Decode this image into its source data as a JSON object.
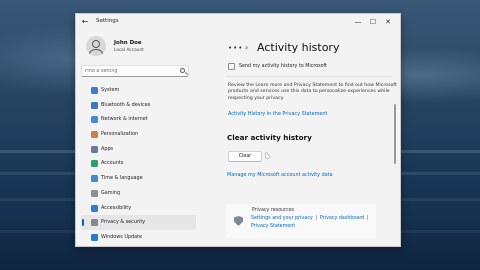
{
  "window": {
    "title": "Settings",
    "controls": {
      "minimize": "—",
      "maximize": "☐",
      "close": "✕"
    }
  },
  "user": {
    "name": "John Doe",
    "account": "Local Account"
  },
  "search": {
    "placeholder": "Find a setting"
  },
  "sidebar": {
    "items": [
      {
        "label": "System",
        "icon": "system-icon",
        "color": "#3b7dd8"
      },
      {
        "label": "Bluetooth & devices",
        "icon": "bluetooth-icon",
        "color": "#3c78c4"
      },
      {
        "label": "Network & internet",
        "icon": "network-icon",
        "color": "#4a88d6"
      },
      {
        "label": "Personalization",
        "icon": "personalization-icon",
        "color": "#d27a4a"
      },
      {
        "label": "Apps",
        "icon": "apps-icon",
        "color": "#6b7c93"
      },
      {
        "label": "Accounts",
        "icon": "accounts-icon",
        "color": "#2f9e6d"
      },
      {
        "label": "Time & language",
        "icon": "time-language-icon",
        "color": "#3a8fd0"
      },
      {
        "label": "Gaming",
        "icon": "gaming-icon",
        "color": "#8b8f97"
      },
      {
        "label": "Accessibility",
        "icon": "accessibility-icon",
        "color": "#2e7fd3"
      },
      {
        "label": "Privacy & security",
        "icon": "privacy-shield-icon",
        "color": "#7f8792"
      },
      {
        "label": "Windows Update",
        "icon": "windows-update-icon",
        "color": "#2b78d0"
      }
    ],
    "active_index": 9
  },
  "breadcrumb": {
    "dots": "•••",
    "separator": "›"
  },
  "page": {
    "title": "Activity history",
    "checkbox_label": "Send my activity history to Microsoft",
    "checkbox_checked": false,
    "description": "Review the Learn more and Privacy Statement to find out how Microsoft products and services use this data to personalize experiences while respecting your privacy.",
    "privacy_link": "Activity History in the Privacy Statement",
    "clear_section_title": "Clear activity history",
    "clear_button": "Clear",
    "manage_link": "Manage my Microsoft account activity data"
  },
  "resources": {
    "title": "Privacy resources",
    "link_1": "Settings and your privacy",
    "link_2": "Privacy dashboard",
    "link_3": "Privacy Statement",
    "separator": "|"
  },
  "colors": {
    "accent": "#0067c0",
    "window_bg": "#f3f3f3"
  }
}
